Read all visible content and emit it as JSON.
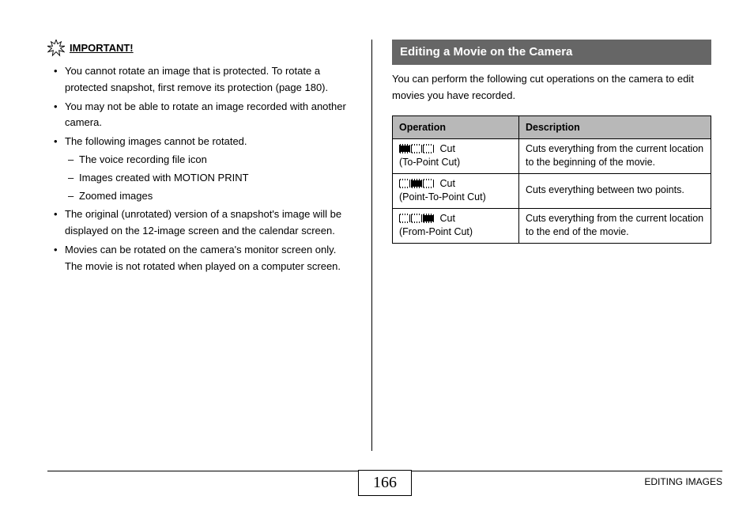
{
  "left": {
    "important_label": "IMPORTANT!",
    "bullets": [
      "You cannot rotate an image that is protected. To rotate a protected snapshot, first remove its protection (page 180).",
      "You may not be able to rotate an image recorded with another camera.",
      "The following images cannot be rotated.",
      "The original (unrotated) version of a snapshot's image will be displayed on the 12-image screen and the calendar screen.",
      "Movies can be rotated on the camera's monitor screen only. The movie is not rotated when played on a computer screen."
    ],
    "sub_dashes": [
      "The voice recording file icon",
      "Images created with MOTION PRINT",
      "Zoomed images"
    ]
  },
  "right": {
    "title": "Editing a Movie on the Camera",
    "intro": "You can perform the following cut operations on the camera to edit movies you have recorded.",
    "th_operation": "Operation",
    "th_description": "Description",
    "rows": [
      {
        "op_label": "Cut",
        "op_sub": "(To-Point Cut)",
        "desc": "Cuts everything from the current location to the beginning of the movie."
      },
      {
        "op_label": "Cut",
        "op_sub": "(Point-To-Point Cut)",
        "desc": "Cuts everything between two points."
      },
      {
        "op_label": "Cut",
        "op_sub": "(From-Point Cut)",
        "desc": "Cuts everything from the current location to the end of the movie."
      }
    ]
  },
  "footer": {
    "page_number": "166",
    "section": "EDITING IMAGES"
  }
}
